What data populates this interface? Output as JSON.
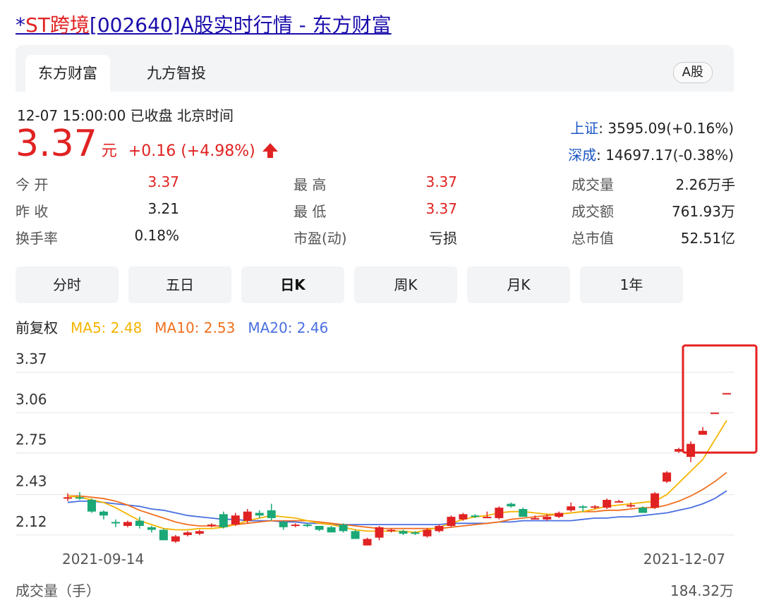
{
  "title": {
    "prefix": "*",
    "name": "ST跨境",
    "rest": "[002640]A股实时行情 - 东方财富"
  },
  "tabs": [
    {
      "label": "东方财富"
    },
    {
      "label": "九方智投"
    }
  ],
  "market_badge": "A股",
  "status": "12-07 15:00:00  已收盘  北京时间",
  "price": {
    "value": "3.37",
    "unit": "元",
    "change": "+0.16 (+4.98%)"
  },
  "indices": [
    {
      "name": "上证",
      "value": ": 3595.09(+0.16%)"
    },
    {
      "name": "深成",
      "value": ": 14697.17(-0.38%)"
    }
  ],
  "stats": [
    [
      {
        "label": "今    开",
        "value": "3.37"
      },
      {
        "label": "最    高",
        "value": "3.37"
      },
      {
        "label": "成交量",
        "value": "2.26万手"
      }
    ],
    [
      {
        "label": "昨    收",
        "value": "3.21"
      },
      {
        "label": "最    低",
        "value": "3.37"
      },
      {
        "label": "成交额",
        "value": "761.93万"
      }
    ],
    [
      {
        "label": "换手率",
        "value": "0.18%"
      },
      {
        "label": "市盈(动)",
        "value": "亏损"
      },
      {
        "label": "总市值",
        "value": "52.51亿"
      }
    ]
  ],
  "periods": [
    "分时",
    "五日",
    "日K",
    "周K",
    "月K",
    "1年"
  ],
  "ma": {
    "label": "前复权",
    "ma5": "MA5: 2.48",
    "ma10": "MA10: 2.53",
    "ma20": "MA20: 2.46"
  },
  "colors": {
    "up": "#e02222",
    "down": "#1aa876",
    "ma5": "#f5b400",
    "ma10": "#f07020",
    "ma20": "#4a6fe0",
    "link": "#1a0dab"
  },
  "chart_data": {
    "type": "candlestick",
    "y_ticks": [
      "3.37",
      "3.06",
      "2.75",
      "2.43",
      "2.12"
    ],
    "ylim": [
      2.06,
      3.37
    ],
    "x_labels": [
      "2021-09-14",
      "2021-12-07"
    ],
    "candles": [
      [
        2.4,
        2.41,
        2.44,
        2.38
      ],
      [
        2.41,
        2.4,
        2.45,
        2.39
      ],
      [
        2.39,
        2.3,
        2.4,
        2.29
      ],
      [
        2.3,
        2.27,
        2.31,
        2.24
      ],
      [
        2.22,
        2.21,
        2.24,
        2.18
      ],
      [
        2.19,
        2.22,
        2.23,
        2.18
      ],
      [
        2.23,
        2.19,
        2.26,
        2.17
      ],
      [
        2.18,
        2.16,
        2.19,
        2.14
      ],
      [
        2.16,
        2.08,
        2.17,
        2.08
      ],
      [
        2.07,
        2.11,
        2.12,
        2.06
      ],
      [
        2.12,
        2.14,
        2.15,
        2.11
      ],
      [
        2.13,
        2.15,
        2.16,
        2.12
      ],
      [
        2.19,
        2.2,
        2.21,
        2.18
      ],
      [
        2.28,
        2.18,
        2.3,
        2.17
      ],
      [
        2.2,
        2.27,
        2.29,
        2.19
      ],
      [
        2.23,
        2.3,
        2.32,
        2.21
      ],
      [
        2.29,
        2.27,
        2.31,
        2.25
      ],
      [
        2.31,
        2.25,
        2.36,
        2.23
      ],
      [
        2.22,
        2.18,
        2.23,
        2.16
      ],
      [
        2.19,
        2.2,
        2.21,
        2.18
      ],
      [
        2.2,
        2.19,
        2.21,
        2.18
      ],
      [
        2.19,
        2.16,
        2.19,
        2.15
      ],
      [
        2.18,
        2.14,
        2.19,
        2.14
      ],
      [
        2.2,
        2.15,
        2.21,
        2.14
      ],
      [
        2.15,
        2.09,
        2.16,
        2.09
      ],
      [
        2.04,
        2.09,
        2.1,
        2.04
      ],
      [
        2.1,
        2.18,
        2.19,
        2.08
      ],
      [
        2.15,
        2.16,
        2.17,
        2.14
      ],
      [
        2.15,
        2.13,
        2.16,
        2.12
      ],
      [
        2.14,
        2.13,
        2.15,
        2.12
      ],
      [
        2.11,
        2.16,
        2.17,
        2.1
      ],
      [
        2.15,
        2.19,
        2.2,
        2.14
      ],
      [
        2.19,
        2.26,
        2.27,
        2.18
      ],
      [
        2.24,
        2.28,
        2.29,
        2.23
      ],
      [
        2.27,
        2.26,
        2.28,
        2.25
      ],
      [
        2.26,
        2.26,
        2.3,
        2.25
      ],
      [
        2.25,
        2.33,
        2.34,
        2.24
      ],
      [
        2.36,
        2.34,
        2.37,
        2.33
      ],
      [
        2.32,
        2.26,
        2.33,
        2.26
      ],
      [
        2.25,
        2.25,
        2.27,
        2.24
      ],
      [
        2.24,
        2.26,
        2.28,
        2.23
      ],
      [
        2.26,
        2.29,
        2.3,
        2.25
      ],
      [
        2.31,
        2.34,
        2.37,
        2.3
      ],
      [
        2.34,
        2.33,
        2.35,
        2.3
      ],
      [
        2.33,
        2.34,
        2.35,
        2.32
      ],
      [
        2.33,
        2.39,
        2.4,
        2.32
      ],
      [
        2.37,
        2.38,
        2.39,
        2.37
      ],
      [
        2.34,
        2.35,
        2.37,
        2.33
      ],
      [
        2.33,
        2.29,
        2.34,
        2.29
      ],
      [
        2.33,
        2.44,
        2.45,
        2.32
      ],
      [
        2.53,
        2.6,
        2.61,
        2.52
      ],
      [
        2.76,
        2.78,
        2.79,
        2.75
      ],
      [
        2.72,
        2.82,
        2.84,
        2.68
      ],
      [
        2.89,
        2.92,
        2.95,
        2.89
      ],
      [
        3.06,
        3.06,
        3.06,
        3.06
      ],
      [
        3.21,
        3.21,
        3.21,
        3.21
      ]
    ],
    "ma5": [
      2.42,
      2.41,
      2.39,
      2.37,
      2.33,
      2.28,
      2.23,
      2.2,
      2.17,
      2.16,
      2.16,
      2.17,
      2.17,
      2.18,
      2.2,
      2.23,
      2.25,
      2.27,
      2.26,
      2.25,
      2.23,
      2.21,
      2.2,
      2.18,
      2.16,
      2.15,
      2.15,
      2.15,
      2.15,
      2.14,
      2.16,
      2.18,
      2.21,
      2.24,
      2.26,
      2.27,
      2.29,
      2.3,
      2.3,
      2.29,
      2.28,
      2.28,
      2.29,
      2.3,
      2.32,
      2.34,
      2.35,
      2.36,
      2.37,
      2.38,
      2.43,
      2.52,
      2.61,
      2.7,
      2.85,
      3.0
    ],
    "ma10": [
      2.42,
      2.42,
      2.41,
      2.4,
      2.38,
      2.35,
      2.31,
      2.28,
      2.25,
      2.22,
      2.2,
      2.19,
      2.19,
      2.19,
      2.2,
      2.21,
      2.22,
      2.23,
      2.23,
      2.23,
      2.23,
      2.22,
      2.21,
      2.2,
      2.19,
      2.18,
      2.17,
      2.17,
      2.17,
      2.17,
      2.17,
      2.17,
      2.18,
      2.19,
      2.2,
      2.21,
      2.22,
      2.24,
      2.25,
      2.26,
      2.27,
      2.28,
      2.29,
      2.3,
      2.3,
      2.31,
      2.31,
      2.32,
      2.33,
      2.33,
      2.35,
      2.38,
      2.42,
      2.47,
      2.53,
      2.6
    ],
    "ma20": [
      2.37,
      2.38,
      2.38,
      2.37,
      2.36,
      2.35,
      2.34,
      2.32,
      2.31,
      2.29,
      2.27,
      2.26,
      2.25,
      2.24,
      2.24,
      2.23,
      2.23,
      2.23,
      2.22,
      2.22,
      2.21,
      2.21,
      2.2,
      2.2,
      2.2,
      2.2,
      2.2,
      2.2,
      2.2,
      2.2,
      2.2,
      2.2,
      2.21,
      2.21,
      2.21,
      2.21,
      2.22,
      2.22,
      2.23,
      2.23,
      2.23,
      2.23,
      2.23,
      2.24,
      2.25,
      2.25,
      2.26,
      2.26,
      2.27,
      2.28,
      2.29,
      2.31,
      2.33,
      2.36,
      2.4,
      2.46
    ]
  },
  "volume": {
    "label": "成交量（手）",
    "max": "184.32万"
  }
}
